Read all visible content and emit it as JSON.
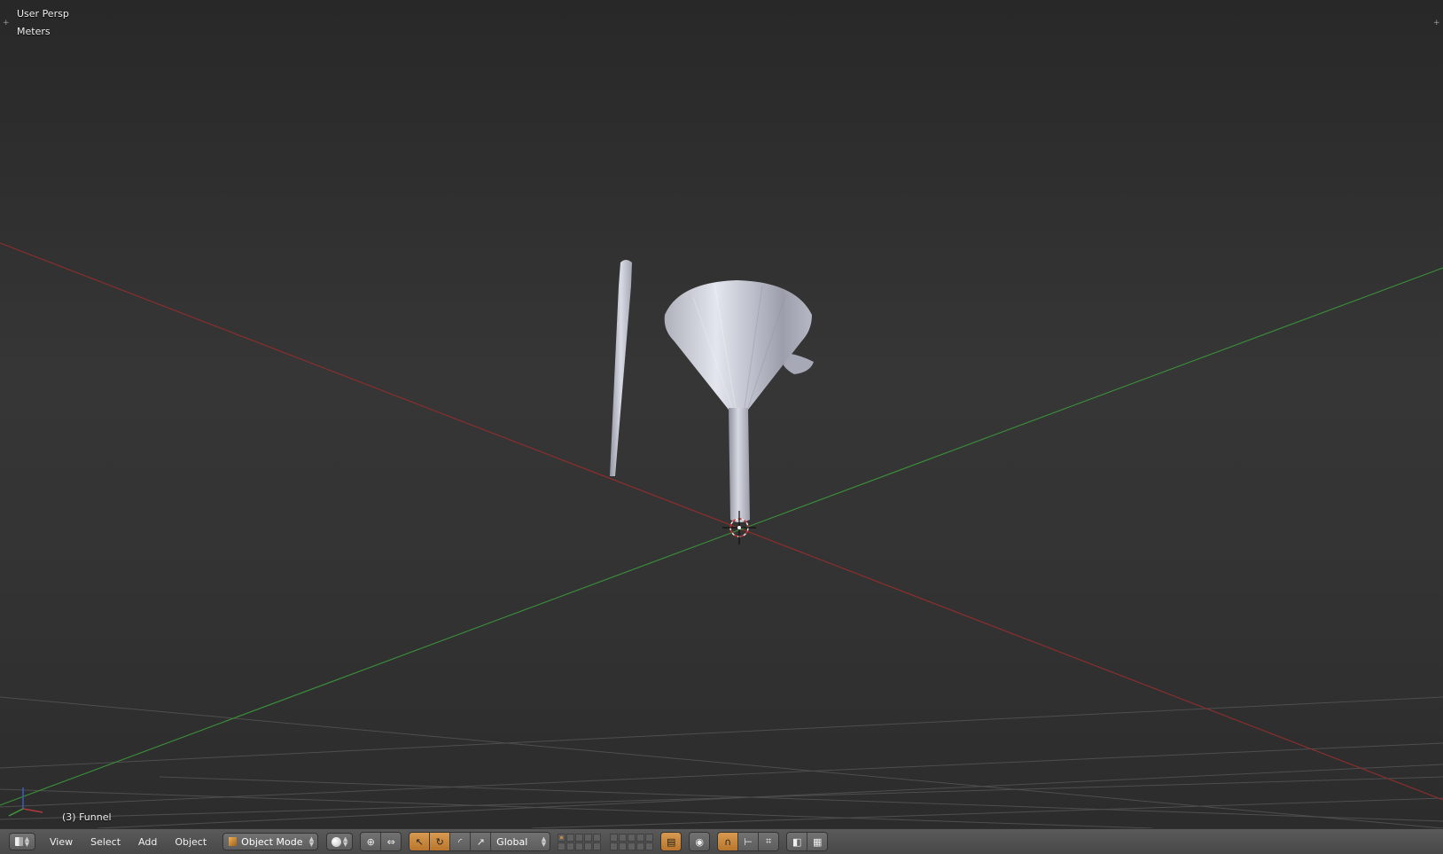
{
  "viewport": {
    "view_label": "User Persp",
    "units_label": "Meters",
    "object_info": "(3) Funnel",
    "corner_plus": "+",
    "axis_colors": {
      "x": "#b03a3a",
      "y": "#3f9a3f",
      "z": "#3a5bc4"
    },
    "grid_color": "#4a4a4a",
    "object_objects": [
      "funnel-mesh",
      "rod-mesh",
      "handle-mesh"
    ]
  },
  "header": {
    "menus": {
      "view": "View",
      "select": "Select",
      "add": "Add",
      "object": "Object"
    },
    "mode": "Object Mode",
    "orientation": "Global",
    "icons": [
      "editor-cube-icon",
      "mode-cube-icon",
      "viewport-shading-icon",
      "pivot-icon",
      "manipulator-icon",
      "translate-icon",
      "rotate-icon",
      "scale-icon",
      "layers-icon",
      "layer-lock-icon",
      "proportional-icon",
      "snap-magnet-icon",
      "snap-element-icon",
      "snap-target-icon",
      "render-icon",
      "camera-icon"
    ],
    "accent_color": "#c9853a"
  }
}
